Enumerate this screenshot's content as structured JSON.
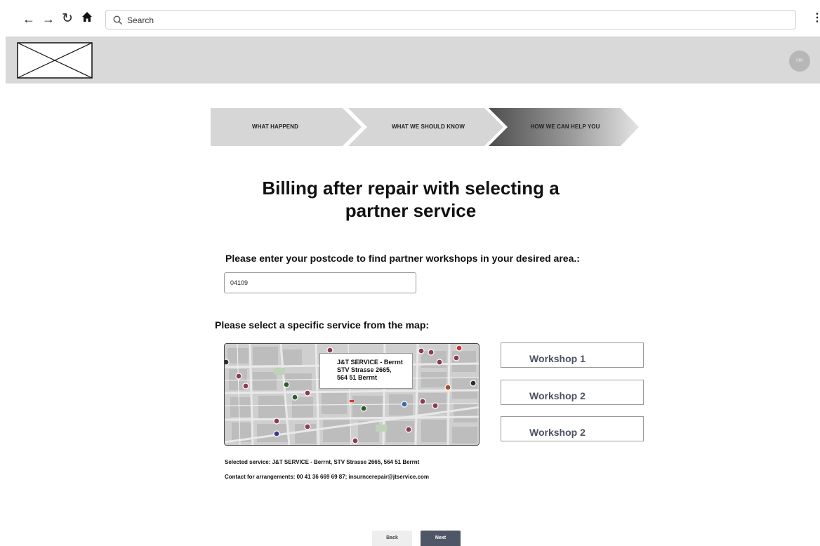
{
  "browser": {
    "search_placeholder": "Search",
    "icons": [
      "back-arrow-icon",
      "forward-arrow-icon",
      "reload-icon",
      "home-icon",
      "search-icon",
      "kebab-menu-icon"
    ],
    "glyphs": {
      "back": "←",
      "forward": "→",
      "reload": "↻",
      "menu": "⋮"
    }
  },
  "header": {
    "avatar_text": "HX"
  },
  "stepper": {
    "steps": [
      {
        "label": "WHAT HAPPEND",
        "state": "done"
      },
      {
        "label": "WHAT WE SHOULD KNOW",
        "state": "done"
      },
      {
        "label": "HOW WE CAN HELP YOU",
        "state": "active"
      }
    ]
  },
  "page": {
    "title_line1": "Billing after repair  with selecting a",
    "title_line2": "partner service",
    "postcode_label": "Please enter your postcode to find partner workshops in your desired area.:",
    "postcode_value": "04109",
    "map_label": "Please select a specific service from the map:"
  },
  "map": {
    "callout_lines": [
      "J&T SERVICE - Berrnt",
      "STV Strasse 2665,",
      "564 51 Berrnt"
    ]
  },
  "workshops": [
    "Workshop 1",
    "Workshop 2",
    "Workshop 2"
  ],
  "info": {
    "selected_service": "Selected service: J&T SERVICE - Berrnt, STV Strasse 2665, 564 51 Berrnt",
    "contact": "Contact for arrangements: 00 41 36 669 69 87; insurncerepair@jtservice.com"
  },
  "actions": {
    "back": "Back",
    "next": "Next"
  },
  "colors": {
    "header_band": "#d9d9d9",
    "step_inactive": "#d6d6d6",
    "step_active_dark": "#5b5b5b",
    "workshop_text": "#4a5264",
    "next_button": "#4f5766"
  }
}
